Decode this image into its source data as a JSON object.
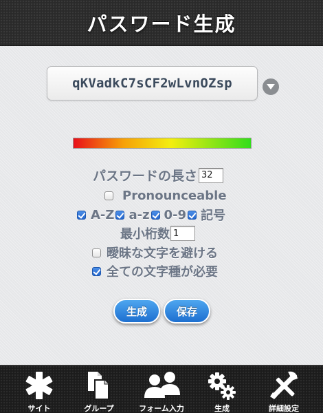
{
  "header": {
    "title": "パスワード生成"
  },
  "password": {
    "value": "qKVadkC7sCF2wLvnOZsp"
  },
  "colors": {
    "strength_gradient": [
      "#e8101a",
      "#f7a008",
      "#f3ee10",
      "#33dd1a"
    ],
    "button_blue": "#2a80e0",
    "label_gray": "#6c7686"
  },
  "options": {
    "length_label": "パスワードの長さ",
    "length_value": "32",
    "pronounceable_label": "Pronounceable",
    "pronounceable_checked": false,
    "upper_label": "A-Z",
    "upper_checked": true,
    "lower_label": "a-z",
    "lower_checked": true,
    "digits_label": "0-9",
    "digits_checked": true,
    "symbols_label": "記号",
    "symbols_checked": true,
    "min_digits_label": "最小桁数",
    "min_digits_value": "1",
    "avoid_ambiguous_label": "曖昧な文字を避ける",
    "avoid_ambiguous_checked": false,
    "require_all_label": "全ての文字種が必要",
    "require_all_checked": true
  },
  "buttons": {
    "generate": "生成",
    "save": "保存"
  },
  "tabs": [
    {
      "label": "サイト",
      "icon": "asterisk-icon"
    },
    {
      "label": "グループ",
      "icon": "documents-icon"
    },
    {
      "label": "フォーム入力",
      "icon": "people-icon"
    },
    {
      "label": "生成",
      "icon": "gears-icon"
    },
    {
      "label": "詳細設定",
      "icon": "tools-icon"
    }
  ]
}
